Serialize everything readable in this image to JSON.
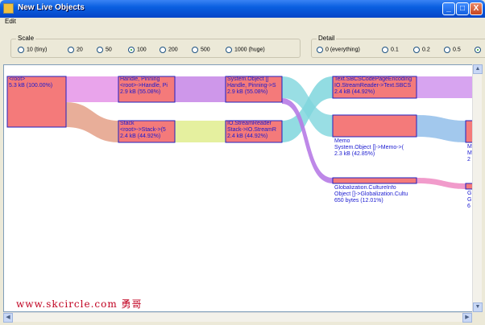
{
  "window": {
    "title": "New Live Objects",
    "buttons": {
      "minimize": "_",
      "maximize": "□",
      "close": "X"
    }
  },
  "menu": {
    "edit": "Edit"
  },
  "scale": {
    "label": "Scale",
    "options": [
      "10 (tiny)",
      "20",
      "50",
      "100",
      "200",
      "500",
      "1000 (huge)"
    ],
    "selected": "100"
  },
  "detail": {
    "label": "Detail",
    "options": [
      "0 (everything)",
      "0.1",
      "0.2",
      "0.5",
      ""
    ],
    "selected": ""
  },
  "nodes": {
    "root": {
      "line1": "<root>",
      "line2": "5.3 kB    (100.00%)"
    },
    "handle": {
      "line1": "Handle, Pinning",
      "line2": "<root>->Handle, Pi",
      "line3": "2.9 kB    (55.08%)"
    },
    "stack": {
      "line1": "Stack",
      "line2": "<root>->Stack->(5",
      "line3": "2.4 kB    (44.92%)"
    },
    "sysobj": {
      "line1": "System.Object []",
      "line2": "Handle,  Pinning->S",
      "line3": "2.9 kB    (55.08%)"
    },
    "streamreader": {
      "line1": "IO.StreamReader",
      "line2": "Stack->IO.StreamR",
      "line3": "2.4 kB    (44.92%)"
    },
    "sbcs": {
      "line1": "Text.SBCSCodePageEncoding",
      "line2": "IO.StreamReader->Text.SBCS",
      "line3": "2.4 kB    (44.92%)"
    },
    "memo": {
      "line1": "Memo",
      "line2": "System.Object  []->Memo->(",
      "line3": "2.3 kB    (42.85%)"
    },
    "culture": {
      "line1": "Globalization.CultureInfo",
      "line2": "Object  []->Globalization.Cultu",
      "line3": "650 bytes (12.01%)"
    },
    "clipped_a": {
      "line1": "M",
      "line2": "M",
      "line3": "2"
    },
    "clipped_b": {
      "line1": "G",
      "line2": "G",
      "line3": "6"
    }
  },
  "colors": {
    "node_fill": "#f47a7a",
    "node_border": "#2020c0",
    "magenta": "#e79ae9",
    "salmon": "#e6a58e",
    "yellow": "#e4ef9a",
    "cyan": "#7fd6dd",
    "purple": "#c98ce8",
    "skyblue": "#9dc5ec",
    "pink": "#f096c8"
  },
  "watermark": "www.skcircle.com 勇哥"
}
